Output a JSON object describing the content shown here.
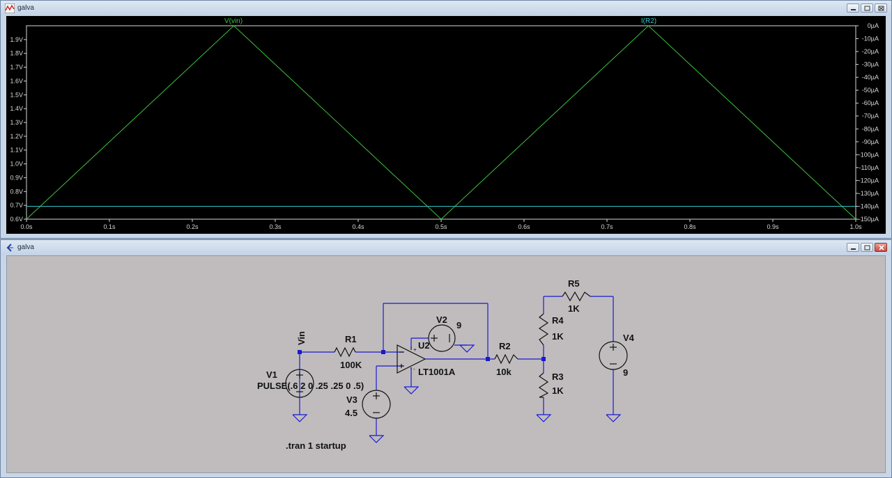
{
  "plot_window": {
    "title": "galva",
    "trace_labels": [
      "V(vin)",
      "I(R2)"
    ]
  },
  "schematic_window": {
    "title": "galva",
    "components": {
      "v1": {
        "name": "V1",
        "value": "PULSE(.6 2 0 .25 .25 0 .5)"
      },
      "v2": {
        "name": "V2",
        "value": "9"
      },
      "v3": {
        "name": "V3",
        "value": "4.5"
      },
      "v4": {
        "name": "V4",
        "value": "9"
      },
      "r1": {
        "name": "R1",
        "value": "100K"
      },
      "r2": {
        "name": "R2",
        "value": "10k"
      },
      "r3": {
        "name": "R3",
        "value": "1K"
      },
      "r4": {
        "name": "R4",
        "value": "1K"
      },
      "r5": {
        "name": "R5",
        "value": "1K"
      },
      "u2": {
        "name": "U2",
        "value": "LT1001A"
      }
    },
    "net_label": "Vin",
    "directive": ".tran 1 startup"
  },
  "colors": {
    "trace_vin": "#3fc23f",
    "trace_ir2": "#35c6c6",
    "axis": "#d8d8d8",
    "wire": "#1a1acc",
    "component": "#111111"
  },
  "chart_data": {
    "type": "line",
    "x_ticks": [
      "0.0s",
      "0.1s",
      "0.2s",
      "0.3s",
      "0.4s",
      "0.5s",
      "0.6s",
      "0.7s",
      "0.8s",
      "0.9s",
      "1.0s"
    ],
    "y_left_ticks": [
      "0.6V",
      "0.7V",
      "0.8V",
      "0.9V",
      "1.0V",
      "1.1V",
      "1.2V",
      "1.3V",
      "1.4V",
      "1.5V",
      "1.6V",
      "1.7V",
      "1.8V",
      "1.9V"
    ],
    "y_right_ticks": [
      "-150µA",
      "-140µA",
      "-130µA",
      "-120µA",
      "-110µA",
      "-100µA",
      "-90µA",
      "-80µA",
      "-70µA",
      "-60µA",
      "-50µA",
      "-40µA",
      "-30µA",
      "-20µA",
      "-10µA",
      "0µA"
    ],
    "xlim": [
      0,
      1
    ],
    "ylim_left": [
      0.6,
      2.0
    ],
    "ylim_right": [
      -150,
      0
    ],
    "series": [
      {
        "name": "V(vin)",
        "axis": "left",
        "x": [
          0,
          0.25,
          0.5,
          0.75,
          1.0
        ],
        "y": [
          0.6,
          2.0,
          0.6,
          2.0,
          0.6
        ]
      },
      {
        "name": "I(R2)",
        "axis": "right",
        "x": [
          0,
          1.0
        ],
        "y": [
          -140,
          -140
        ]
      }
    ]
  }
}
